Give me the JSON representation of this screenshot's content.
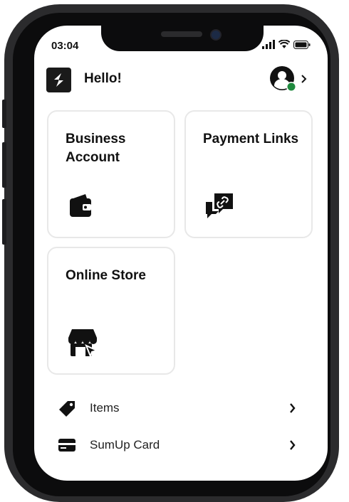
{
  "status_bar": {
    "time": "03:04"
  },
  "header": {
    "greeting": "Hello!"
  },
  "tiles": [
    {
      "title": "Business Account",
      "icon": "wallet-icon"
    },
    {
      "title": "Payment Links",
      "icon": "payment-link-chat-icon"
    },
    {
      "title": "Online Store",
      "icon": "storefront-icon"
    }
  ],
  "list": [
    {
      "label": "Items",
      "icon": "tag-icon"
    },
    {
      "label": "SumUp Card",
      "icon": "card-icon"
    }
  ],
  "colors": {
    "accent": "#1a1a1a",
    "online_status": "#1f8a3e",
    "card_border": "#e8e8e8"
  }
}
